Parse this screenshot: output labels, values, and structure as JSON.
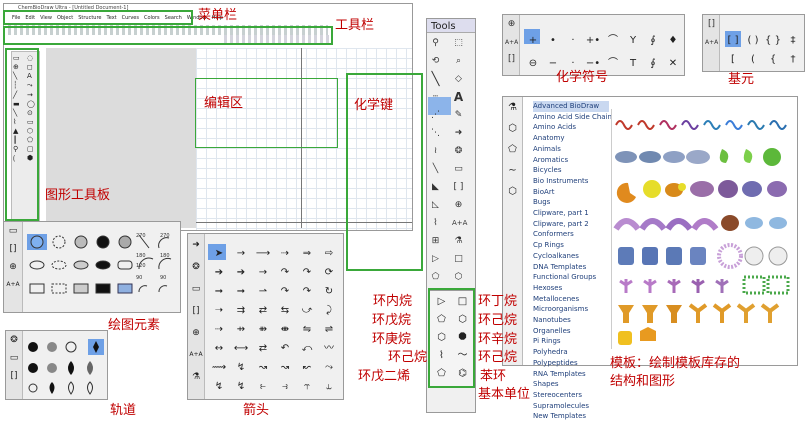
{
  "labels": {
    "menubar": "菜单栏",
    "toolbar": "工具栏",
    "editor": "编辑区",
    "bond": "化学键",
    "chem_symbol": "化学符号",
    "base_unit": "基元",
    "graphic_palette": "图形工具板",
    "drawing_elements": "绘图元素",
    "orbitals": "轨道",
    "arrows": "箭头",
    "ring_left_1": "环内烷",
    "ring_left_2": "环戊烷",
    "ring_left_3": "环庚烷",
    "ring_left_4": "环己烷",
    "ring_left_5": "环戊二烯",
    "ring_right_1": "环丁烷",
    "ring_right_2": "环己烷",
    "ring_right_3": "环辛烷",
    "ring_right_4": "环己烷",
    "ring_right_5": "苯环",
    "basic_unit": "基本单位",
    "template_caption_1": "模板：绘制模板库存的",
    "template_caption_2": "结构和图形"
  },
  "app": {
    "title": "ChemBioDraw Ultra - [Untitled Document-1]",
    "menu": [
      "File",
      "Edit",
      "View",
      "Object",
      "Structure",
      "Text",
      "Curves",
      "Colors",
      "Search",
      "Window",
      "Help"
    ]
  },
  "tools_panel": {
    "title": "Tools"
  },
  "chem_symbols": [
    "+",
    "•",
    "·",
    "+•",
    "⌒",
    "Y",
    "∮",
    "♦",
    "⊖",
    "−",
    "·",
    "−•",
    "⌒",
    "T",
    "∮",
    "✕"
  ],
  "base_brackets": [
    "[ ]",
    "( )",
    "{ }",
    "‡",
    "[",
    "(",
    "{",
    "†"
  ],
  "templates": [
    "Advanced BioDraw",
    "Amino Acid Side Chains",
    "Amino Acids",
    "Anatomy",
    "Animals",
    "Aromatics",
    "Bicycles",
    "Bio Instruments",
    "BioArt",
    "Bugs",
    "Clipware, part 1",
    "Clipware, part 2",
    "Conformers",
    "Cp Rings",
    "Cycloalkanes",
    "DNA Templates",
    "Functional Groups",
    "Hexoses",
    "Metallocenes",
    "Microorganisms",
    "Nanotubes",
    "Organelles",
    "Pi Rings",
    "Polyhedra",
    "Polypeptides",
    "RNA Templates",
    "Shapes",
    "Stereocenters",
    "Supramolecules",
    "",
    "New Templates"
  ],
  "drawing_numbers": [
    "270",
    "270",
    "180",
    "180",
    "120",
    "120",
    "90",
    "90"
  ],
  "colors": {
    "label": "#c00000",
    "box": "#3aa83a",
    "selected": "#2f7fd6"
  }
}
